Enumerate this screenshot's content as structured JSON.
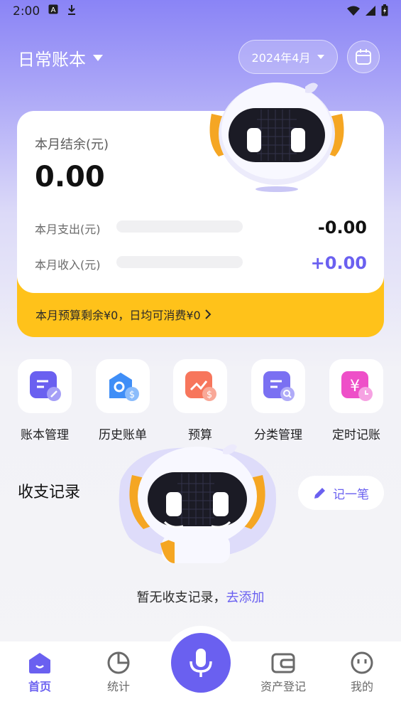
{
  "status_bar": {
    "time": "2:00"
  },
  "header": {
    "book_title": "日常账本",
    "date": "2024年4月"
  },
  "summary": {
    "balance_label": "本月结余(元)",
    "balance_value": "0.00",
    "expense_label": "本月支出(元)",
    "expense_value": "-0.00",
    "income_label": "本月收入(元)",
    "income_value": "+0.00",
    "budget_text": "本月预算剩余¥0，日均可消费¥0"
  },
  "quick_actions": [
    {
      "label": "账本管理",
      "icon": "ledger-manage-icon"
    },
    {
      "label": "历史账单",
      "icon": "history-bill-icon"
    },
    {
      "label": "预算",
      "icon": "budget-icon"
    },
    {
      "label": "分类管理",
      "icon": "category-manage-icon"
    },
    {
      "label": "定时记账",
      "icon": "scheduled-entry-icon"
    }
  ],
  "records": {
    "title": "收支记录",
    "add_button": "记一笔",
    "empty_text": "暂无收支记录，",
    "empty_link": "去添加"
  },
  "nav": {
    "home": "首页",
    "stats": "统计",
    "assets": "资产登记",
    "mine": "我的"
  },
  "colors": {
    "accent": "#6a60f0",
    "budget_band": "#ffc21a",
    "header_gradient": "#8a84f6"
  }
}
